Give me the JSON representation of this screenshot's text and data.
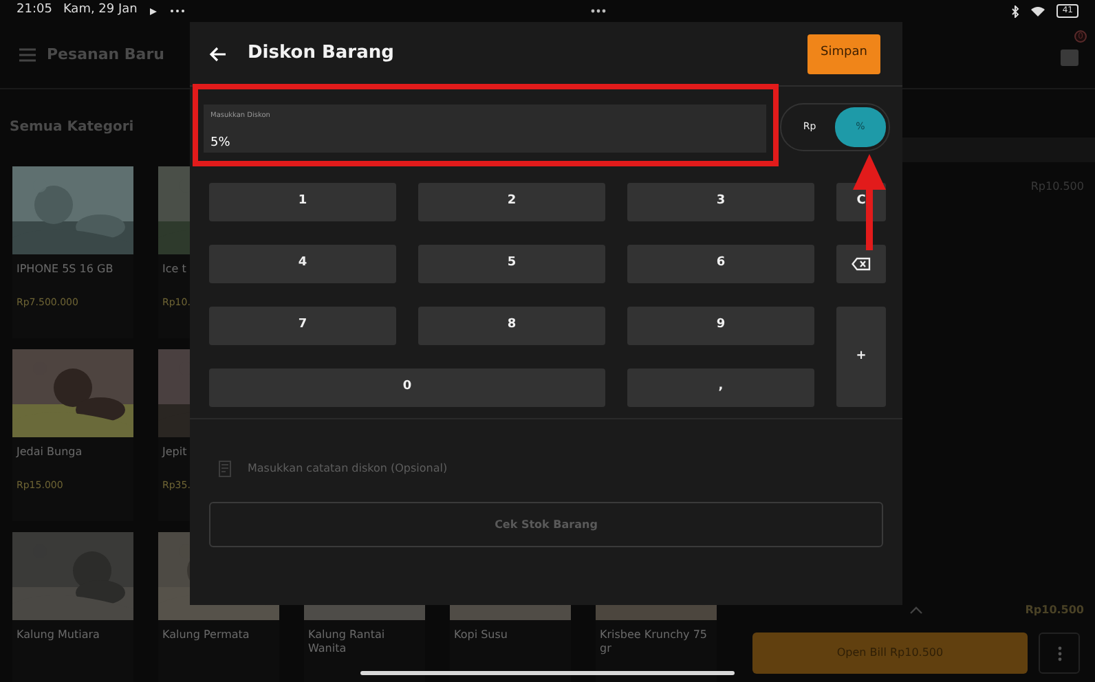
{
  "status_bar": {
    "time": "21:05",
    "date": "Kam, 29 Jan",
    "battery": "41"
  },
  "header": {
    "title": "Pesanan Baru",
    "cart_badge": "0"
  },
  "category": "Semua Kategori",
  "products": [
    {
      "name": "IPHONE 5S 16 GB",
      "price": "Rp7.500.000"
    },
    {
      "name": "Ice t",
      "price": "Rp10."
    },
    {
      "name": "Jedai Bunga",
      "price": "Rp15.000"
    },
    {
      "name": "Jepit",
      "price": "Rp35."
    },
    {
      "name": "Kalung Mutiara"
    },
    {
      "name": "Kalung Permata"
    },
    {
      "name": "Kalung Rantai Wanita"
    },
    {
      "name": "Kopi Susu"
    },
    {
      "name": "Krisbee Krunchy 75 gr"
    }
  ],
  "order_panel": {
    "item_price": "Rp10.500",
    "total": "Rp10.500",
    "open_bill": "Open Bill Rp10.500"
  },
  "dialog": {
    "title": "Diskon Barang",
    "save": "Simpan",
    "field": {
      "label": "Masukkan Diskon",
      "value": "5%"
    },
    "units": [
      {
        "label": "Rp",
        "selected": false
      },
      {
        "label": "%",
        "selected": true
      }
    ],
    "keys": [
      {
        "kind": "digit",
        "label": "1"
      },
      {
        "kind": "digit",
        "label": "2"
      },
      {
        "kind": "digit",
        "label": "3"
      },
      {
        "kind": "digit",
        "label": "C"
      },
      {
        "kind": "digit",
        "label": "4"
      },
      {
        "kind": "digit",
        "label": "5"
      },
      {
        "kind": "digit",
        "label": "6"
      },
      {
        "kind": "backspace"
      },
      {
        "kind": "digit",
        "label": "7"
      },
      {
        "kind": "digit",
        "label": "8"
      },
      {
        "kind": "digit",
        "label": "9"
      },
      {
        "kind": "tall",
        "label": "+"
      },
      {
        "kind": "wide",
        "label": "0"
      },
      {
        "kind": "digit",
        "label": ","
      }
    ],
    "note": {
      "placeholder": "Masukkan catatan diskon (Opsional)"
    },
    "stock_button": "Cek Stok Barang"
  }
}
